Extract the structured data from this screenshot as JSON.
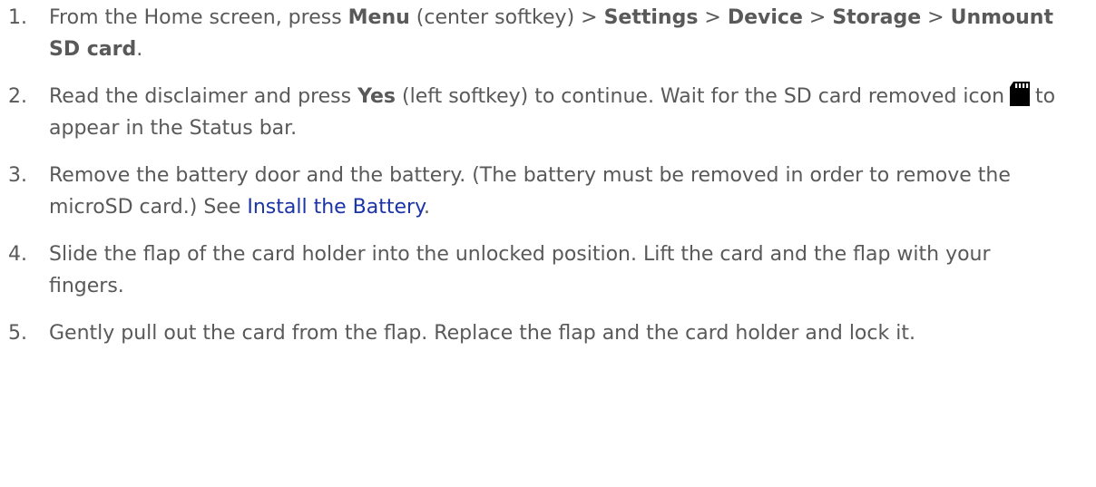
{
  "steps": [
    {
      "num": "1.",
      "t1": "From the Home screen, press ",
      "b1": "Menu",
      "t2": " (center softkey) > ",
      "b2": "Settings",
      "t3": " > ",
      "b3": "Device",
      "t4": " > ",
      "b4": "Storage",
      "t5": " > ",
      "b5": "Unmount SD card",
      "t6": "."
    },
    {
      "num": "2.",
      "t1": "Read the disclaimer and press ",
      "b1": "Yes",
      "t2": " (left softkey) to continue. Wait for the SD card removed icon",
      "t3": "to appear in the Status bar.",
      "icon": "sd-card-removed-icon"
    },
    {
      "num": "3.",
      "t1": "Remove the battery door and the battery. (The battery must be removed in order to remove the microSD card.) See ",
      "link": "Install the Battery",
      "t2": "."
    },
    {
      "num": "4.",
      "t1": "Slide the flap of the card holder into the unlocked position. Lift the card and the flap with your fingers."
    },
    {
      "num": "5.",
      "t1": "Gently pull out the card from the flap. Replace the flap and the card holder and lock it."
    }
  ],
  "colors": {
    "text": "#595959",
    "link": "#1a33a6"
  }
}
